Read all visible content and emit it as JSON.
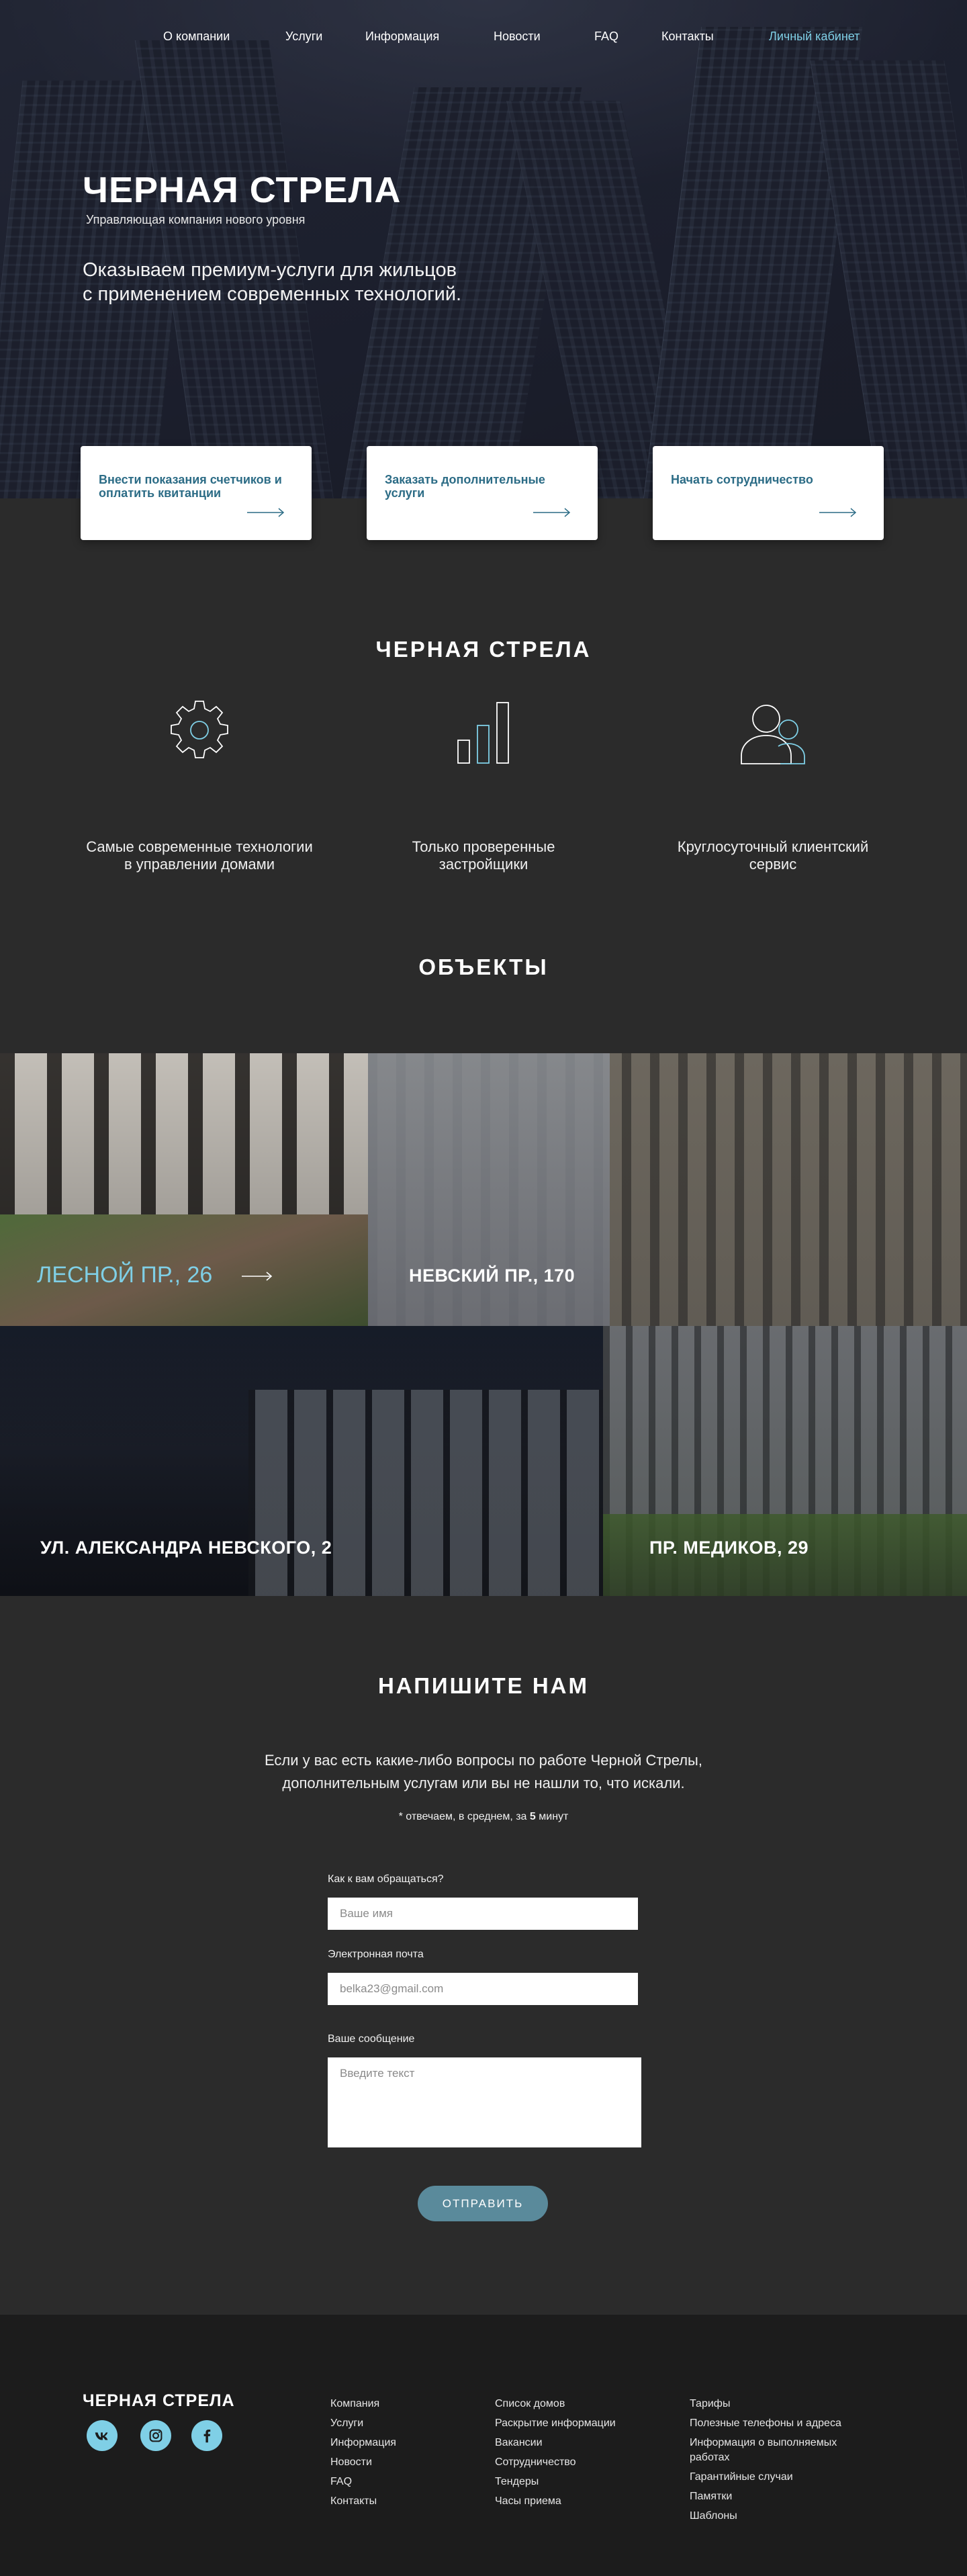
{
  "nav": {
    "items": [
      "О компании",
      "Услуги",
      "Информация",
      "Новости",
      "FAQ",
      "Контакты"
    ],
    "account": "Личный кабинет"
  },
  "hero": {
    "title": "ЧЕРНАЯ СТРЕЛА",
    "subtitle": "Управляющая компания нового уровня",
    "lead_line1": "Оказываем премиум-услуги для жильцов",
    "lead_line2": "с  применением современных технологий."
  },
  "cards": [
    {
      "label": "Внести показания счетчиков и оплатить квитанции"
    },
    {
      "label": "Заказать дополнительные услуги"
    },
    {
      "label": "Начать сотрудничество"
    }
  ],
  "about": {
    "title": "ЧЕРНАЯ СТРЕЛА",
    "features": [
      {
        "icon": "gear-icon",
        "line1": "Самые современные технологии",
        "line2": "в управлении домами"
      },
      {
        "icon": "bar-chart-icon",
        "line1": "Только проверенные",
        "line2": "застройщики"
      },
      {
        "icon": "users-icon",
        "line1": "Круглосуточный клиентский",
        "line2": "сервис"
      }
    ]
  },
  "objects": {
    "title": "ОБЪЕКТЫ",
    "items": [
      "ЛЕСНОЙ ПР., 26",
      "НЕВСКИЙ ПР., 170",
      "УЛ. АЛЕКСАНДРА НЕВСКОГО, 2",
      "ПР. МЕДИКОВ, 29"
    ]
  },
  "contact": {
    "title": "НАПИШИТЕ НАМ",
    "intro_line1": "Если у вас есть какие-либо вопросы  по  работе Черной Стрелы,",
    "intro_line2": "дополнительным услугам или вы не нашли то, что искали.",
    "note_prefix": "* отвечаем, в среднем, за",
    "note_bold": "5",
    "note_suffix": "минут",
    "name_label": "Как к вам обращаться?",
    "name_placeholder": "Ваше имя",
    "email_label": "Электронная почта",
    "email_placeholder": "belka23@gmail.com",
    "message_label": "Ваше сообщение",
    "message_placeholder": "Введите текст",
    "submit": "ОТПРАВИТЬ"
  },
  "footer": {
    "brand": "ЧЕРНАЯ СТРЕЛА",
    "social": [
      "vk-icon",
      "instagram-icon",
      "facebook-icon"
    ],
    "col1": [
      "Компания",
      "Услуги",
      "Информация",
      "Новости",
      "FAQ",
      "Контакты"
    ],
    "col2": [
      "Список домов",
      "Раскрытие информации",
      "Вакансии",
      "Сотрудничество",
      "Тендеры",
      "Часы приема"
    ],
    "col3": [
      "Тарифы",
      "Полезные телефоны и адреса",
      "Информация о выполняемых работах",
      "Гарантийные случаи",
      "Памятки",
      "Шаблоны"
    ]
  },
  "colors": {
    "accent": "#7fcfe6",
    "card_text": "#2c6c86",
    "bg": "#2b2b2b",
    "footer_bg": "#1c1c1c",
    "button": "#5a8a9b"
  }
}
